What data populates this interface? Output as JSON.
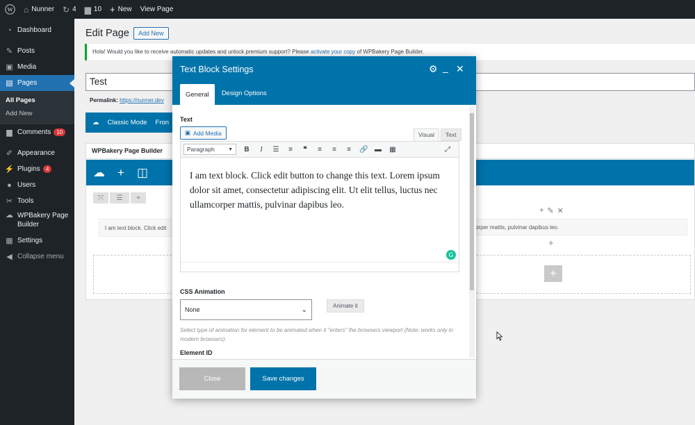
{
  "adminbar": {
    "site_name": "Nunner",
    "updates_count": "4",
    "comments_count": "10",
    "new_label": "New",
    "view_page_label": "View Page"
  },
  "sidebar": {
    "items": [
      {
        "label": "Dashboard",
        "icon": "dashboard-icon"
      },
      {
        "label": "Posts",
        "icon": "pin-icon"
      },
      {
        "label": "Media",
        "icon": "media-icon"
      },
      {
        "label": "Pages",
        "icon": "pages-icon"
      },
      {
        "label": "Comments",
        "icon": "comment-icon",
        "badge": "10"
      },
      {
        "label": "Appearance",
        "icon": "brush-icon"
      },
      {
        "label": "Plugins",
        "icon": "plug-icon",
        "badge": "4"
      },
      {
        "label": "Users",
        "icon": "user-icon"
      },
      {
        "label": "Tools",
        "icon": "wrench-icon"
      },
      {
        "label": "WPBakery Page Builder",
        "icon": "cloud-icon"
      },
      {
        "label": "Settings",
        "icon": "settings-icon"
      },
      {
        "label": "Collapse menu",
        "icon": "collapse-icon"
      }
    ],
    "submenu": [
      "All Pages",
      "Add New"
    ]
  },
  "main": {
    "page_title": "Edit Page",
    "add_new_label": "Add New",
    "notice_text": "Hola! Would you like to receive automatic updates and unlock premium support? Please ",
    "notice_link": "activate your copy",
    "notice_text_end": " of WPBakery Page Builder.",
    "title_value": "Test",
    "permalink_label": "Permalink:",
    "permalink_url": "https://nunner.dev",
    "classic_mode_label": "Classic Mode",
    "frontend_partial": "Fron",
    "wpb_panel_title": "WPBakery Page Builder",
    "text_block_preview_left": "I am text block. Click edit",
    "text_block_preview_right": "orper mattis, pulvinar dapibus leo."
  },
  "modal": {
    "title": "Text Block Settings",
    "tabs": [
      "General",
      "Design Options"
    ],
    "text_label": "Text",
    "add_media_label": "Add Media",
    "editor_tabs": [
      "Visual",
      "Text"
    ],
    "format_value": "Paragraph",
    "editor_content": "I am text block. Click edit button to change this text. Lorem ipsum dolor sit amet, consectetur adipiscing elit. Ut elit tellus, luctus nec ullamcorper mattis, pulvinar dapibus leo.",
    "css_animation_label": "CSS Animation",
    "css_animation_value": "None",
    "animate_button_label": "Animate it",
    "css_animation_help": "Select type of animation for element to be animated when it \"enters\" the browsers viewport (Note: works only in modern browsers).",
    "element_id_label": "Element ID",
    "close_label": "Close",
    "save_label": "Save changes"
  },
  "colors": {
    "accent": "#0073aa",
    "admin_dark": "#1d2327",
    "active_menu": "#2271b1"
  }
}
